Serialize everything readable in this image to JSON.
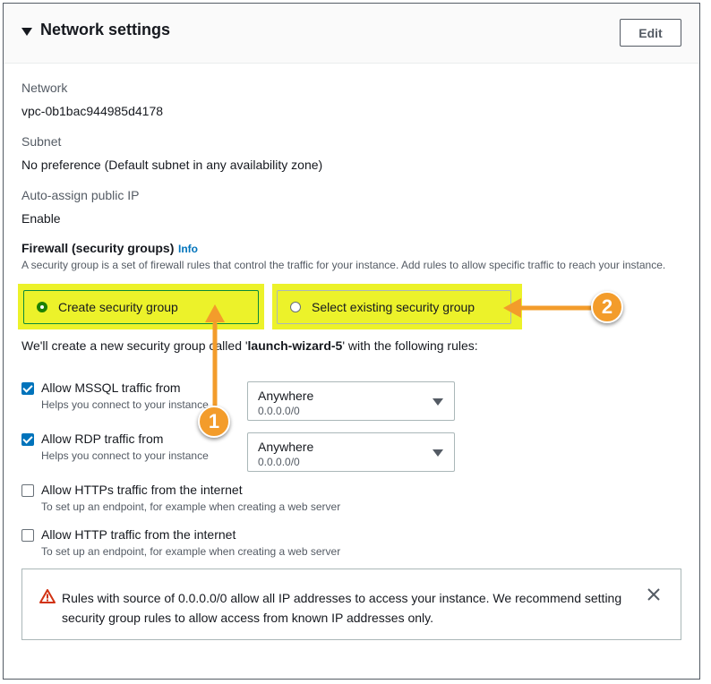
{
  "panel": {
    "title": "Network settings",
    "edit_label": "Edit"
  },
  "fields": {
    "network_label": "Network",
    "network_value": "vpc-0b1bac944985d4178",
    "subnet_label": "Subnet",
    "subnet_value": "No preference (Default subnet in any availability zone)",
    "public_ip_label": "Auto-assign public IP",
    "public_ip_value": "Enable"
  },
  "firewall": {
    "title": "Firewall (security groups)",
    "info_label": "Info",
    "description": "A security group is a set of firewall rules that control the traffic for your instance. Add rules to allow specific traffic to reach your instance.",
    "options": [
      {
        "label": "Create security group",
        "selected": true
      },
      {
        "label": "Select existing security group",
        "selected": false
      }
    ],
    "create_prefix": "We'll create a new security group called '",
    "group_name": "launch-wizard-5",
    "create_suffix": "' with the following rules:"
  },
  "rules": [
    {
      "title": "Allow MSSQL traffic from",
      "description": "Helps you connect to your instance",
      "checked": true,
      "source": "Anywhere",
      "cidr": "0.0.0.0/0"
    },
    {
      "title": "Allow RDP traffic from",
      "description": "Helps you connect to your instance",
      "checked": true,
      "source": "Anywhere",
      "cidr": "0.0.0.0/0"
    },
    {
      "title": "Allow HTTPs traffic from the internet",
      "description": "To set up an endpoint, for example when creating a web server",
      "checked": false
    },
    {
      "title": "Allow HTTP traffic from the internet",
      "description": "To set up an endpoint, for example when creating a web server",
      "checked": false
    }
  ],
  "alert": {
    "text": "Rules with source of 0.0.0.0/0 allow all IP addresses to access your instance. We recommend setting security group rules to allow access from known IP addresses only."
  },
  "annotations": {
    "badge_1": "1",
    "badge_2": "2"
  },
  "colors": {
    "highlight": "#ecf22a",
    "annotation": "#f39c2b",
    "selected_radio": "#1d8102",
    "checkbox": "#0073bb",
    "link": "#0073bb"
  }
}
